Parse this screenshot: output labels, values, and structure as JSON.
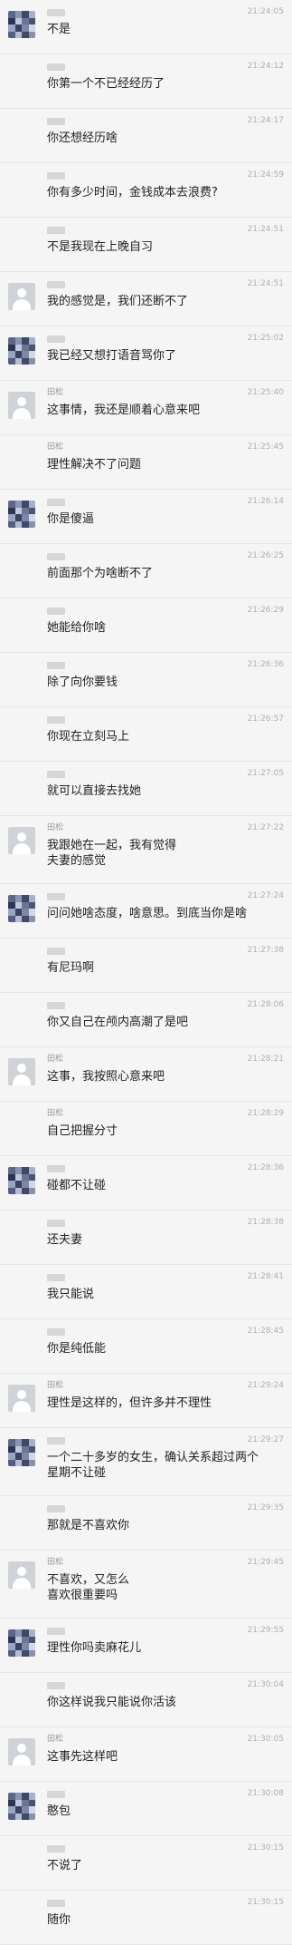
{
  "messages": [
    {
      "sender": "",
      "sender_blurred": true,
      "avatar": "pixel",
      "time": "21:24:05",
      "text": "不是"
    },
    {
      "sender": "",
      "sender_blurred": true,
      "avatar": "none",
      "time": "21:24:12",
      "text": "你第一个不已经经历了"
    },
    {
      "sender": "",
      "sender_blurred": true,
      "avatar": "none",
      "time": "21:24:17",
      "text": "你还想经历啥"
    },
    {
      "sender": "",
      "sender_blurred": true,
      "avatar": "none",
      "time": "21:24:59",
      "text": "你有多少时间，金钱成本去浪费?"
    },
    {
      "sender": "",
      "sender_blurred": true,
      "avatar": "none",
      "time": "21:24:51",
      "text": "不是我现在上晚自习"
    },
    {
      "sender": "",
      "sender_blurred": true,
      "avatar": "default",
      "time": "21:24:51",
      "text": "我的感觉是，我们还断不了"
    },
    {
      "sender": "",
      "sender_blurred": true,
      "avatar": "pixel",
      "time": "21:25:02",
      "text": "我已经又想打语音骂你了"
    },
    {
      "sender": "田松",
      "sender_blurred": false,
      "avatar": "default",
      "time": "21:25:40",
      "text": "这事情，我还是顺着心意来吧"
    },
    {
      "sender": "田松",
      "sender_blurred": false,
      "avatar": "none",
      "time": "21:25:45",
      "text": "理性解决不了问题"
    },
    {
      "sender": "",
      "sender_blurred": true,
      "avatar": "pixel",
      "time": "21:26:14",
      "text": "你是傻逼"
    },
    {
      "sender": "",
      "sender_blurred": true,
      "avatar": "none",
      "time": "21:26:25",
      "text": "前面那个为啥断不了"
    },
    {
      "sender": "",
      "sender_blurred": true,
      "avatar": "none",
      "time": "21:26:29",
      "text": "她能给你啥"
    },
    {
      "sender": "",
      "sender_blurred": true,
      "avatar": "none",
      "time": "21:26:36",
      "text": "除了向你要钱"
    },
    {
      "sender": "",
      "sender_blurred": true,
      "avatar": "none",
      "time": "21:26:57",
      "text": "你现在立刻马上"
    },
    {
      "sender": "",
      "sender_blurred": true,
      "avatar": "none",
      "time": "21:27:05",
      "text": "就可以直接去找她"
    },
    {
      "sender": "田松",
      "sender_blurred": false,
      "avatar": "default",
      "time": "21:27:22",
      "text": "我跟她在一起，我有觉得\n夫妻的感觉"
    },
    {
      "sender": "",
      "sender_blurred": true,
      "avatar": "pixel",
      "time": "21:27:24",
      "text": "问问她啥态度，啥意思。到底当你是啥"
    },
    {
      "sender": "",
      "sender_blurred": true,
      "avatar": "none",
      "time": "21:27:38",
      "text": "有尼玛啊"
    },
    {
      "sender": "",
      "sender_blurred": true,
      "avatar": "none",
      "time": "21:28:06",
      "text": "你又自己在颅内高潮了是吧"
    },
    {
      "sender": "田松",
      "sender_blurred": false,
      "avatar": "default",
      "time": "21:28:21",
      "text": "这事，我按照心意来吧"
    },
    {
      "sender": "田松",
      "sender_blurred": false,
      "avatar": "none",
      "time": "21:28:29",
      "text": "自己把握分寸"
    },
    {
      "sender": "",
      "sender_blurred": true,
      "avatar": "pixel",
      "time": "21:28:36",
      "text": "碰都不让碰"
    },
    {
      "sender": "",
      "sender_blurred": true,
      "avatar": "none",
      "time": "21:28:38",
      "text": "还夫妻"
    },
    {
      "sender": "",
      "sender_blurred": true,
      "avatar": "none",
      "time": "21:28:41",
      "text": "我只能说"
    },
    {
      "sender": "",
      "sender_blurred": true,
      "avatar": "none",
      "time": "21:28:45",
      "text": "你是纯低能"
    },
    {
      "sender": "田松",
      "sender_blurred": false,
      "avatar": "default",
      "time": "21:29:24",
      "text": "理性是这样的，但许多并不理性"
    },
    {
      "sender": "",
      "sender_blurred": true,
      "avatar": "pixel",
      "time": "21:29:27",
      "text": "一个二十多岁的女生，确认关系超过两个\n星期不让碰"
    },
    {
      "sender": "",
      "sender_blurred": true,
      "avatar": "none",
      "time": "21:29:35",
      "text": "那就是不喜欢你"
    },
    {
      "sender": "田松",
      "sender_blurred": false,
      "avatar": "default",
      "time": "21:29:45",
      "text": "不喜欢，又怎么\n喜欢很重要吗"
    },
    {
      "sender": "",
      "sender_blurred": true,
      "avatar": "pixel",
      "time": "21:29:55",
      "text": "理性你吗卖麻花儿"
    },
    {
      "sender": "",
      "sender_blurred": true,
      "avatar": "none",
      "time": "21:30:04",
      "text": "你这样说我只能说你活该"
    },
    {
      "sender": "田松",
      "sender_blurred": false,
      "avatar": "default",
      "time": "21:30:05",
      "text": "这事先这样吧"
    },
    {
      "sender": "",
      "sender_blurred": true,
      "avatar": "pixel",
      "time": "21:30:08",
      "text": "憨包"
    },
    {
      "sender": "",
      "sender_blurred": true,
      "avatar": "none",
      "time": "21:30:15",
      "text": "不说了"
    },
    {
      "sender": "",
      "sender_blurred": true,
      "avatar": "none",
      "time": "21:30:15",
      "text": "随你"
    }
  ]
}
